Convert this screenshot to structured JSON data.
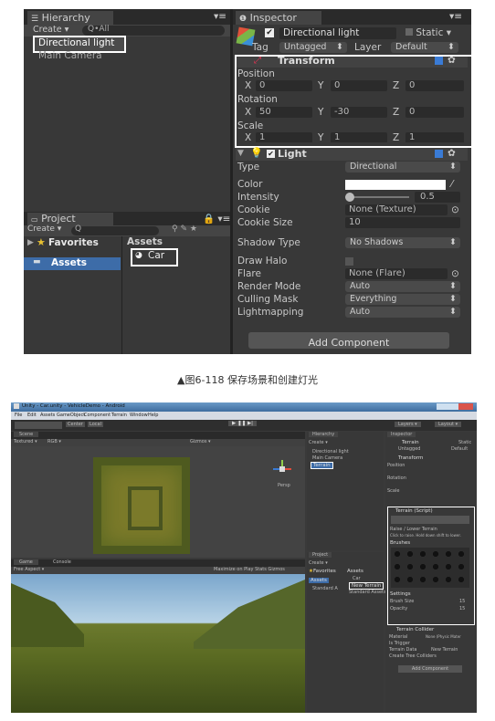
{
  "top": {
    "hierarchy": {
      "tab": "Hierarchy",
      "create": "Create",
      "search": "Q•All",
      "items": [
        "Directional light",
        "Main Camera"
      ]
    },
    "project": {
      "tab": "Project",
      "create": "Create",
      "favorites": "Favorites",
      "assets_header": "Assets",
      "assets": "Assets",
      "car": "Car"
    },
    "inspector": {
      "tab": "Inspector",
      "object_name": "Directional light",
      "static": "Static",
      "tag_label": "Tag",
      "tag_value": "Untagged",
      "layer_label": "Layer",
      "layer_value": "Default",
      "transform": {
        "title": "Transform",
        "position": "Position",
        "rotation": "Rotation",
        "scale": "Scale",
        "pos": {
          "x": "0",
          "y": "0",
          "z": "0"
        },
        "rot": {
          "x": "50",
          "y": "-30",
          "z": "0"
        },
        "scl": {
          "x": "1",
          "y": "1",
          "z": "1"
        },
        "axis_x": "X",
        "axis_y": "Y",
        "axis_z": "Z"
      },
      "light": {
        "title": "Light",
        "rows": [
          {
            "label": "Type",
            "value": "Directional"
          },
          {
            "label": "Color",
            "value": ""
          },
          {
            "label": "Intensity",
            "value": "0.5"
          },
          {
            "label": "Cookie",
            "value": "None (Texture)"
          },
          {
            "label": "Cookie Size",
            "value": "10"
          },
          {
            "label": "Shadow Type",
            "value": "No Shadows"
          },
          {
            "label": "Draw Halo",
            "value": ""
          },
          {
            "label": "Flare",
            "value": "None (Flare)"
          },
          {
            "label": "Render Mode",
            "value": "Auto"
          },
          {
            "label": "Culling Mask",
            "value": "Everything"
          },
          {
            "label": "Lightmapping",
            "value": "Auto"
          }
        ]
      },
      "add_component": "Add Component"
    },
    "colors": {
      "bg": "#383838",
      "white": "#ffffff",
      "selection": "#3d6ca8"
    }
  },
  "caption1": "▲图6-118 保存场景和创建灯光",
  "bottom": {
    "title_bar": "Unity - Car.unity - VehicleDemo - Android",
    "menu": [
      "File",
      "Edit",
      "Assets",
      "GameObject",
      "Component",
      "Terrain",
      "Window",
      "Help"
    ],
    "toolbar": {
      "center": "Center",
      "local": "Local",
      "layers": "Layers",
      "layout": "Layout"
    },
    "scene_tab": "Scene",
    "textured": "Textured",
    "rgb": "RGB",
    "gizmos": "Gizmos",
    "persp": "Persp",
    "game_tab": "Game",
    "console_tab": "Console",
    "free_aspect": "Free Aspect",
    "maximize": "Maximize on Play  Stats  Gizmos",
    "hierarchy": {
      "tab": "Hierarchy",
      "create": "Create",
      "items": [
        "Directional light",
        "Main Camera",
        "Terrain"
      ]
    },
    "project": {
      "tab": "Project",
      "create": "Create",
      "favorites": "Favorites",
      "assets": "Assets",
      "standard": "Standard A",
      "items": [
        "Car",
        "New Terrain",
        "Standard Assets"
      ]
    },
    "inspector": {
      "tab": "Inspector",
      "name": "Terrain",
      "static": "Static",
      "tag": "Untagged",
      "layer": "Default",
      "transform": "Transform",
      "position": "Position",
      "rotation": "Rotation",
      "scale": "Scale",
      "terrain_script": "Terrain (Script)",
      "raise_lower": "Raise / Lower Terrain",
      "hint": "Click to raise. Hold down shift to lower.",
      "brushes": "Brushes",
      "settings": "Settings",
      "brush_size": "Brush Size",
      "opacity": "Opacity",
      "brush_size_val": "15",
      "opacity_val": "15",
      "collider": "Terrain Collider",
      "material": "Material",
      "material_val": "None (Physic Mater",
      "is_trigger": "Is Trigger",
      "terrain_data": "Terrain Data",
      "terrain_data_val": "New Terrain",
      "tree_colliders": "Create Tree Colliders",
      "add_component": "Add Component"
    }
  }
}
